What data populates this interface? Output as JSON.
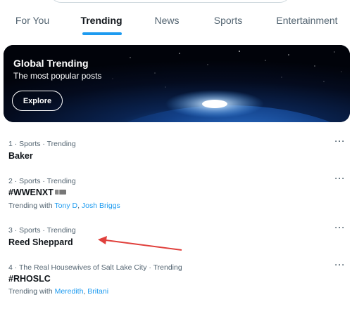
{
  "tabs": [
    {
      "label": "For You",
      "active": false
    },
    {
      "label": "Trending",
      "active": true
    },
    {
      "label": "News",
      "active": false
    },
    {
      "label": "Sports",
      "active": false
    },
    {
      "label": "Entertainment",
      "active": false
    }
  ],
  "banner": {
    "title": "Global Trending",
    "subtitle": "The most popular posts",
    "button_label": "Explore"
  },
  "trends": [
    {
      "meta": "1 · Sports · Trending",
      "name": "Baker"
    },
    {
      "meta": "2 · Sports · Trending",
      "name": "#WWENXT",
      "hashflag_icon": "wwe-nxt-logo-icon",
      "with_prefix": "Trending with",
      "with_users": [
        "Tony D",
        "Josh Briggs"
      ]
    },
    {
      "meta": "3 · Sports · Trending",
      "name": "Reed Sheppard"
    },
    {
      "meta": "4 · The Real Housewives of Salt Lake City · Trending",
      "name": "#RHOSLC",
      "with_prefix": "Trending with",
      "with_users": [
        "Meredith",
        "Britani"
      ]
    }
  ],
  "more_label": "···",
  "colors": {
    "accent": "#1d9bf0",
    "text_primary": "#0f1419",
    "text_secondary": "#536471",
    "annotation_arrow": "#e0403c"
  }
}
